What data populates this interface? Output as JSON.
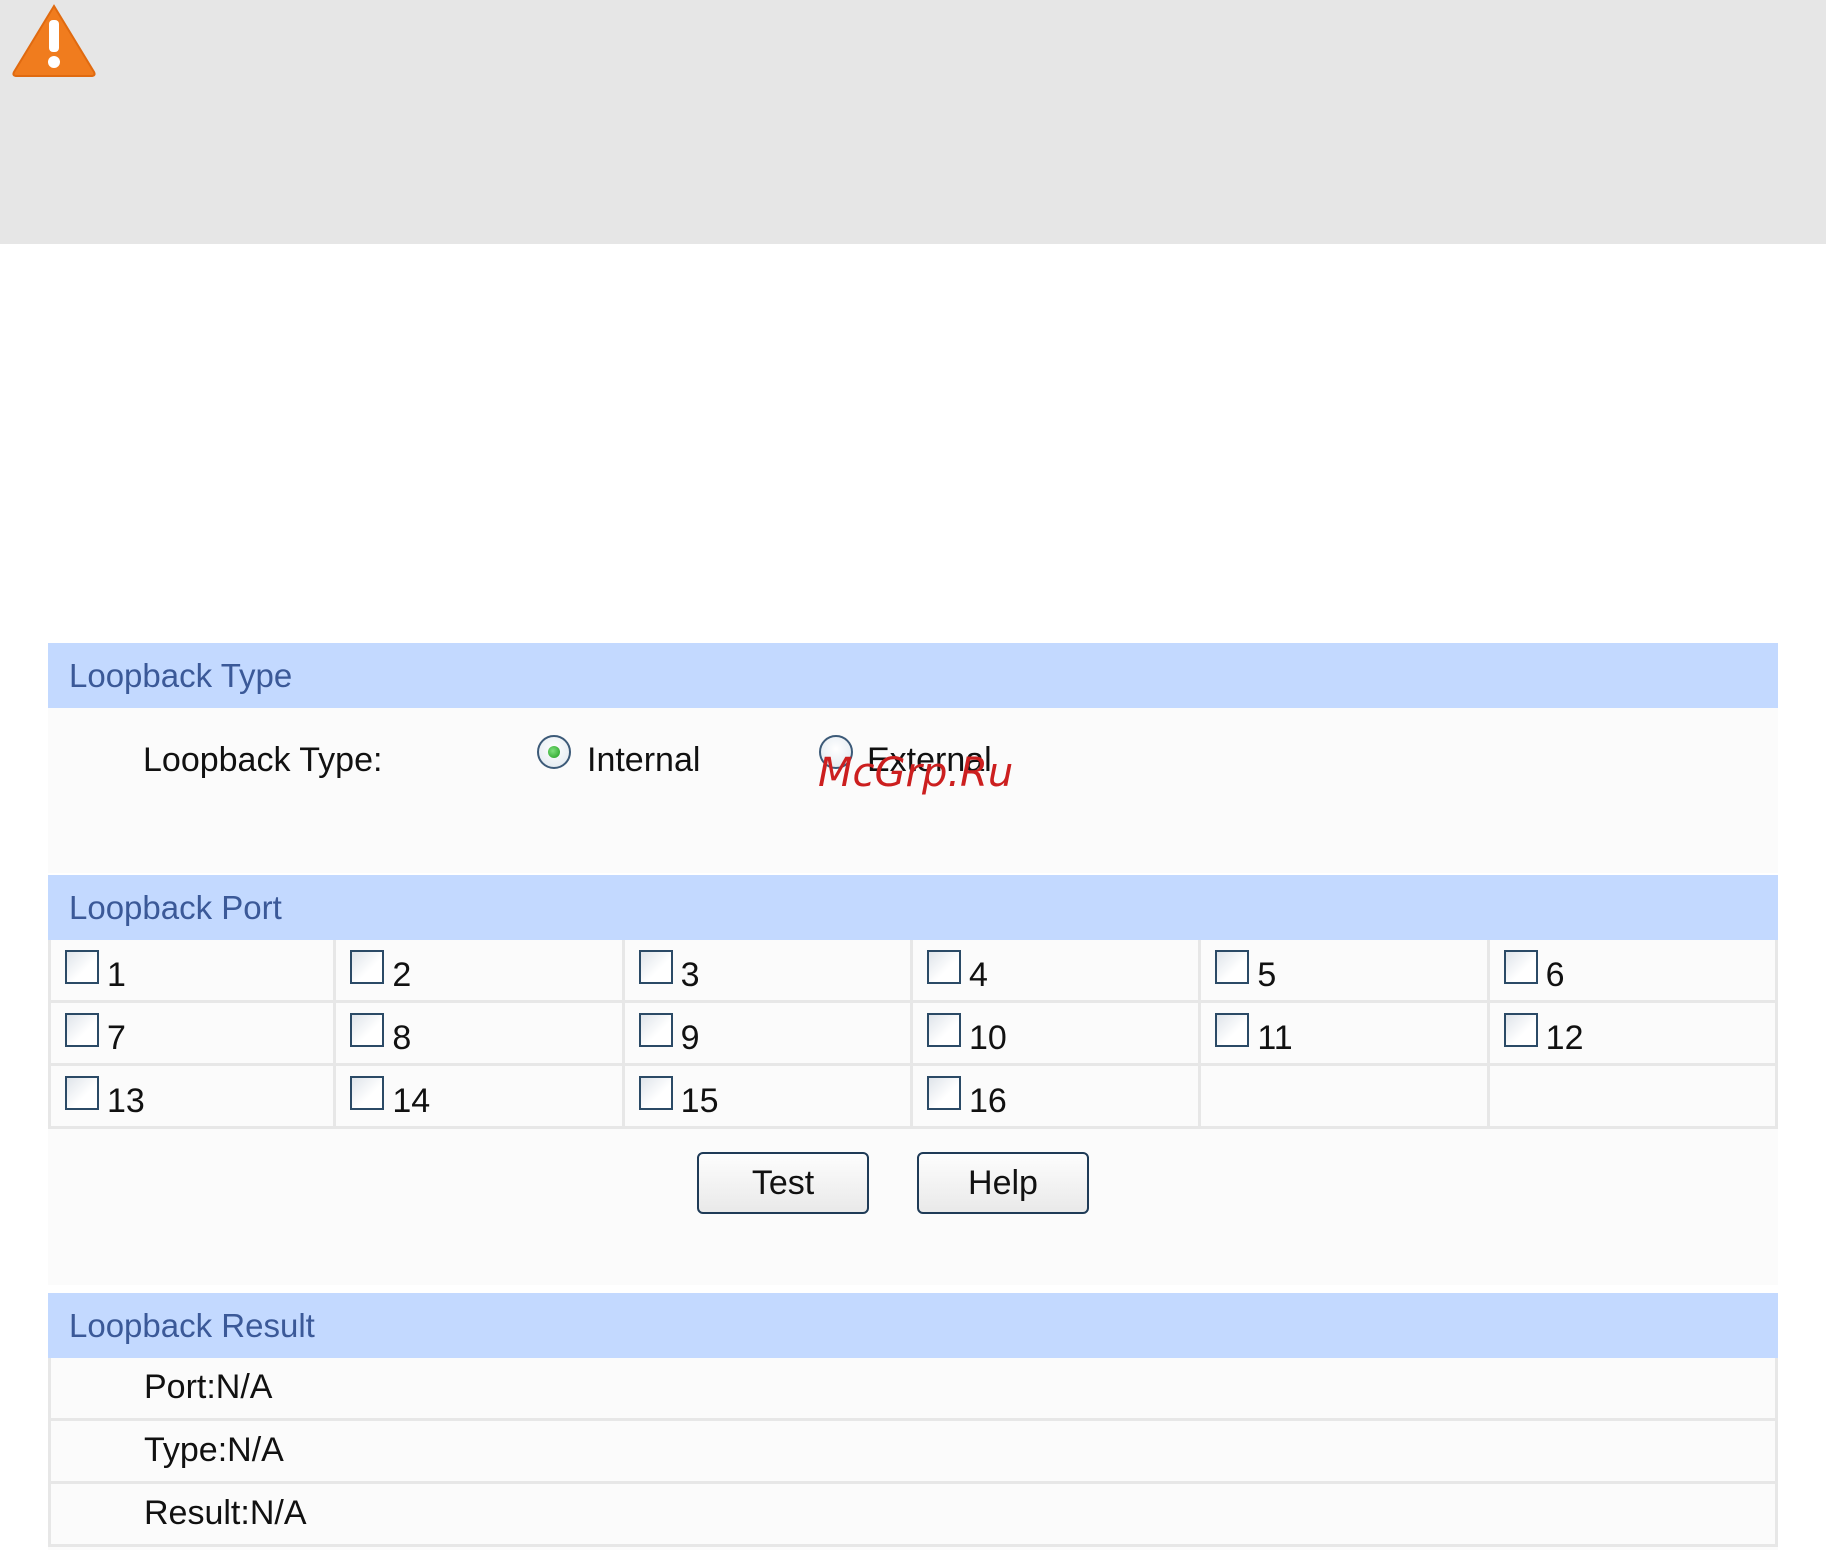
{
  "warning": {
    "icon": "warning-triangle-icon",
    "icon_color": "#f07c1e"
  },
  "loopback_type_section": {
    "header": "Loopback Type",
    "field_label": "Loopback Type:",
    "options": [
      {
        "label": "Internal",
        "selected": true
      },
      {
        "label": "External",
        "selected": false
      }
    ]
  },
  "loopback_port_section": {
    "header": "Loopback Port",
    "ports": [
      "1",
      "2",
      "3",
      "4",
      "5",
      "6",
      "7",
      "8",
      "9",
      "10",
      "11",
      "12",
      "13",
      "14",
      "15",
      "16"
    ]
  },
  "buttons": {
    "test": "Test",
    "help": "Help"
  },
  "loopback_result_section": {
    "header": "Loopback Result",
    "rows": [
      "Port:N/A",
      "Type:N/A",
      "Result:N/A"
    ]
  },
  "watermark": "McGrp.Ru",
  "colors": {
    "section_header_bg": "#c3d9ff",
    "section_header_text": "#3b5998",
    "warning_band": "#e6e6e6"
  }
}
